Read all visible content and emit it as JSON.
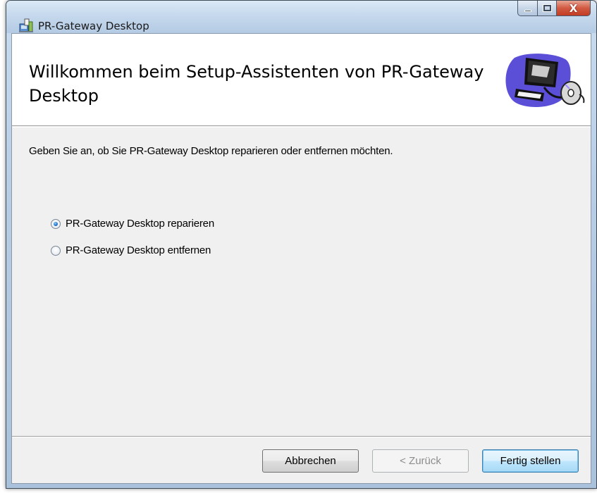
{
  "window": {
    "title": "PR-Gateway Desktop",
    "close_glyph": "X",
    "icon": "installer-app-icon"
  },
  "banner": {
    "title": "Willkommen beim Setup-Assistenten von PR-Gateway Desktop",
    "icon": "computer-cd-icon"
  },
  "description": "Geben Sie an, ob Sie PR-Gateway Desktop reparieren oder entfernen möchten.",
  "options": [
    {
      "label": "PR-Gateway Desktop reparieren",
      "checked": true
    },
    {
      "label": "PR-Gateway Desktop entfernen",
      "checked": false
    }
  ],
  "buttons": {
    "cancel": "Abbrechen",
    "back": "< Zurück",
    "finish": "Fertig stellen"
  },
  "colors": {
    "titlebar": "#c4d7ec",
    "client_bg": "#f0f0f0",
    "close_button": "#c23b23",
    "default_button_border": "#3c7fb1"
  }
}
